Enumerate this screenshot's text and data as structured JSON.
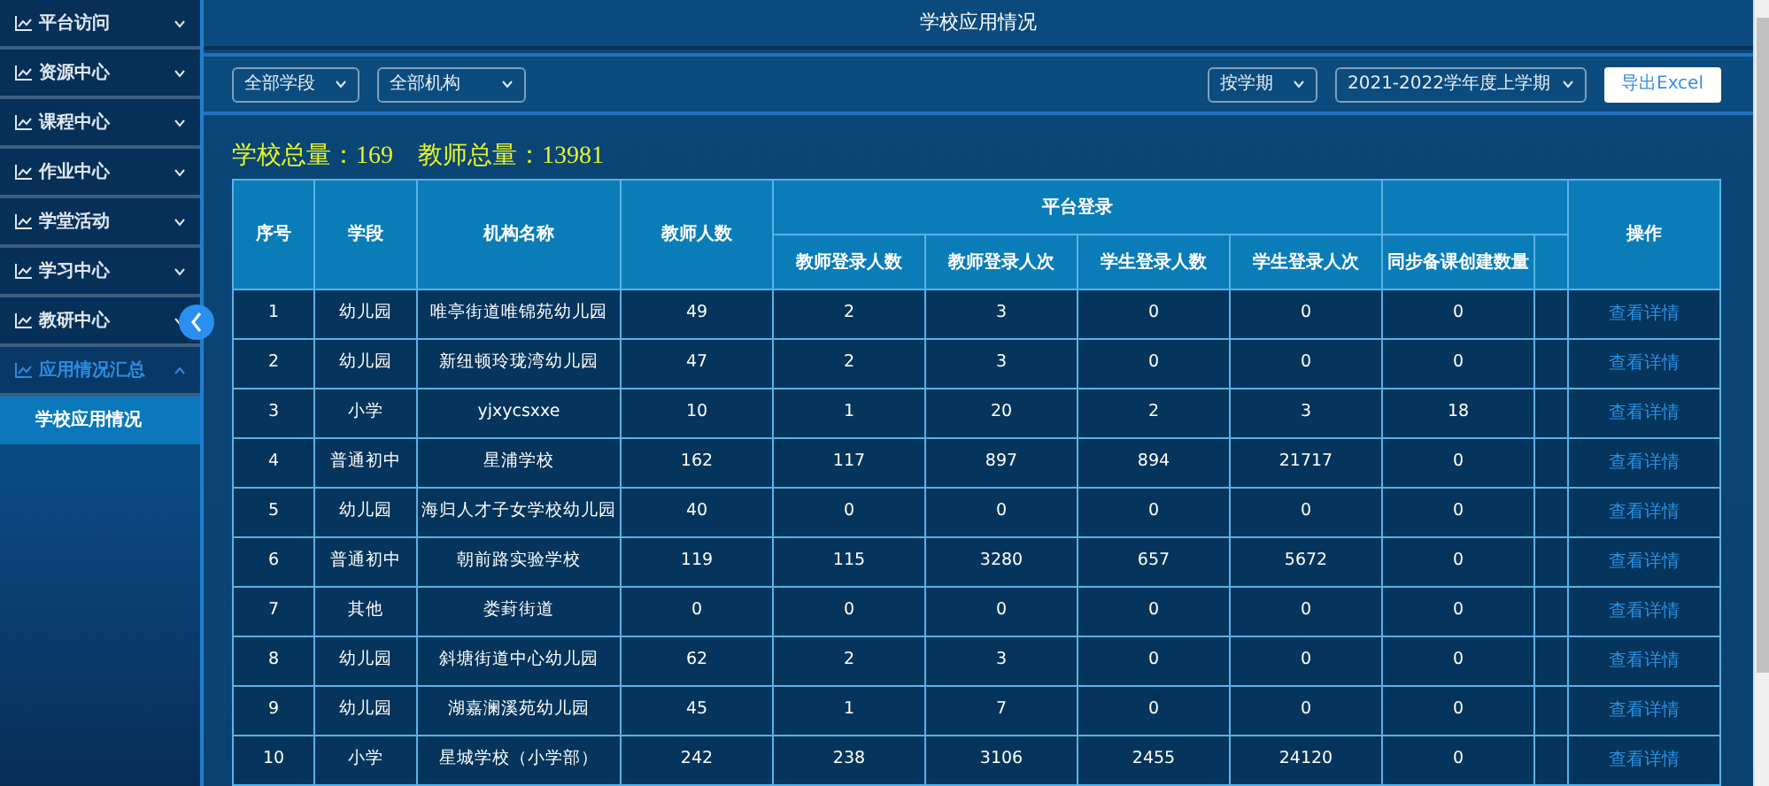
{
  "sidebar": {
    "items": [
      {
        "label": "平台访问",
        "expanded": false,
        "selected": false
      },
      {
        "label": "资源中心",
        "expanded": false,
        "selected": false
      },
      {
        "label": "课程中心",
        "expanded": false,
        "selected": false
      },
      {
        "label": "作业中心",
        "expanded": false,
        "selected": false
      },
      {
        "label": "学堂活动",
        "expanded": false,
        "selected": false
      },
      {
        "label": "学习中心",
        "expanded": false,
        "selected": false
      },
      {
        "label": "教研中心",
        "expanded": false,
        "selected": false
      },
      {
        "label": "应用情况汇总",
        "expanded": true,
        "selected": true,
        "children": [
          {
            "label": "学校应用情况",
            "selected": true
          }
        ]
      }
    ]
  },
  "header": {
    "title": "学校应用情况"
  },
  "filters": {
    "left": [
      "全部学段",
      "全部机构"
    ],
    "right": [
      "按学期",
      "2021-2022学年度上学期"
    ],
    "export_button": "导出Excel"
  },
  "summary": [
    "学校总量：169",
    "教师总量：13981"
  ],
  "table": {
    "leading_columns": [
      "序号",
      "学段",
      "机构名称",
      "教师人数"
    ],
    "group": {
      "label": "平台登录",
      "columns": [
        "教师登录人数",
        "教师登录人次",
        "学生登录人数",
        "学生登录人次"
      ]
    },
    "trailing_columns": [
      "同步备课创建数量"
    ],
    "action_column": "操作",
    "rows": [
      {
        "cells": [
          "1",
          "幼儿园",
          "唯亭街道唯锦苑幼儿园",
          "49",
          "2",
          "3",
          "0",
          "0",
          "0"
        ],
        "action": "查看详情"
      },
      {
        "cells": [
          "2",
          "幼儿园",
          "新纽顿玲珑湾幼儿园",
          "47",
          "2",
          "3",
          "0",
          "0",
          "0"
        ],
        "action": "查看详情"
      },
      {
        "cells": [
          "3",
          "小学",
          "yjxycsxxe",
          "10",
          "1",
          "20",
          "2",
          "3",
          "18"
        ],
        "action": "查看详情"
      },
      {
        "cells": [
          "4",
          "普通初中",
          "星浦学校",
          "162",
          "117",
          "897",
          "894",
          "21717",
          "0"
        ],
        "action": "查看详情"
      },
      {
        "cells": [
          "5",
          "幼儿园",
          "海归人才子女学校幼儿园",
          "40",
          "0",
          "0",
          "0",
          "0",
          "0"
        ],
        "action": "查看详情"
      },
      {
        "cells": [
          "6",
          "普通初中",
          "朝前路实验学校",
          "119",
          "115",
          "3280",
          "657",
          "5672",
          "0"
        ],
        "action": "查看详情"
      },
      {
        "cells": [
          "7",
          "其他",
          "娄葑街道",
          "0",
          "0",
          "0",
          "0",
          "0",
          "0"
        ],
        "action": "查看详情"
      },
      {
        "cells": [
          "8",
          "幼儿园",
          "斜塘街道中心幼儿园",
          "62",
          "2",
          "3",
          "0",
          "0",
          "0"
        ],
        "action": "查看详情"
      },
      {
        "cells": [
          "9",
          "幼儿园",
          "湖嘉澜溪苑幼儿园",
          "45",
          "1",
          "7",
          "0",
          "0",
          "0"
        ],
        "action": "查看详情"
      },
      {
        "cells": [
          "10",
          "小学",
          "星城学校（小学部）",
          "242",
          "238",
          "3106",
          "2455",
          "24120",
          "0"
        ],
        "action": "查看详情"
      }
    ]
  }
}
